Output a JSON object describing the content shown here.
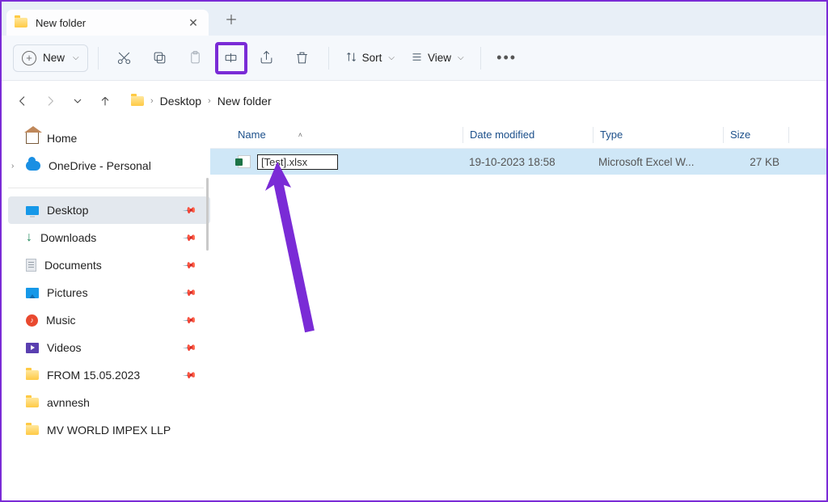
{
  "tab": {
    "title": "New folder"
  },
  "toolbar": {
    "new_label": "New",
    "sort_label": "Sort",
    "view_label": "View"
  },
  "breadcrumbs": {
    "root": "Desktop",
    "current": "New folder"
  },
  "nav": {
    "home": "Home",
    "onedrive": "OneDrive - Personal",
    "items": [
      {
        "label": "Desktop",
        "icon": "desktop",
        "selected": true,
        "pinned": true
      },
      {
        "label": "Downloads",
        "icon": "dl",
        "selected": false,
        "pinned": true
      },
      {
        "label": "Documents",
        "icon": "doc",
        "selected": false,
        "pinned": true
      },
      {
        "label": "Pictures",
        "icon": "pic",
        "selected": false,
        "pinned": true
      },
      {
        "label": "Music",
        "icon": "music",
        "selected": false,
        "pinned": true
      },
      {
        "label": "Videos",
        "icon": "video",
        "selected": false,
        "pinned": true
      },
      {
        "label": "FROM 15.05.2023",
        "icon": "folder",
        "selected": false,
        "pinned": true
      },
      {
        "label": "avnnesh",
        "icon": "folder",
        "selected": false,
        "pinned": false
      },
      {
        "label": "MV WORLD IMPEX LLP",
        "icon": "folder",
        "selected": false,
        "pinned": false
      }
    ]
  },
  "columns": {
    "name": "Name",
    "date_modified": "Date modified",
    "type": "Type",
    "size": "Size"
  },
  "file": {
    "rename_value": "[Test].xlsx",
    "date_modified": "19-10-2023 18:58",
    "type": "Microsoft Excel W...",
    "size": "27 KB"
  }
}
